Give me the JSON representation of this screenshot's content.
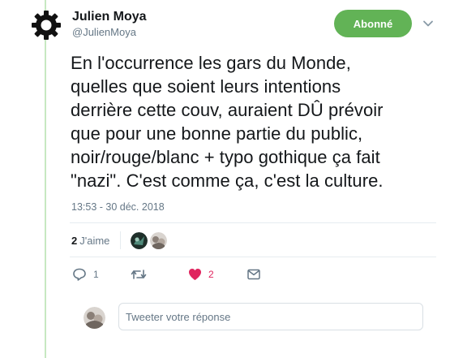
{
  "author": {
    "name": "Julien Moya",
    "handle": "@JulienMoya",
    "avatar_icon": "gear-icon"
  },
  "follow_button": {
    "label": "Abonné",
    "color": "#62b356"
  },
  "tweet": {
    "text": "En l'occurrence les gars du Monde,\nquelles que soient leurs intentions\nderrière cette couv, auraient DÛ prévoir\nque pour une bonne partie du public,\nnoir/rouge/blanc + typo gothique ça fait\n\"nazi\". C'est comme ça, c'est la culture.",
    "timestamp": "13:53 - 30 déc. 2018"
  },
  "likes": {
    "count": "2",
    "label": "J'aime"
  },
  "actions": {
    "reply_count": "1",
    "retweet_count": "",
    "like_count": "2",
    "like_color": "#e0245e"
  },
  "reply": {
    "placeholder": "Tweeter votre réponse"
  },
  "colors": {
    "thread_line": "#c7e8c1",
    "text_secondary": "#657786"
  }
}
